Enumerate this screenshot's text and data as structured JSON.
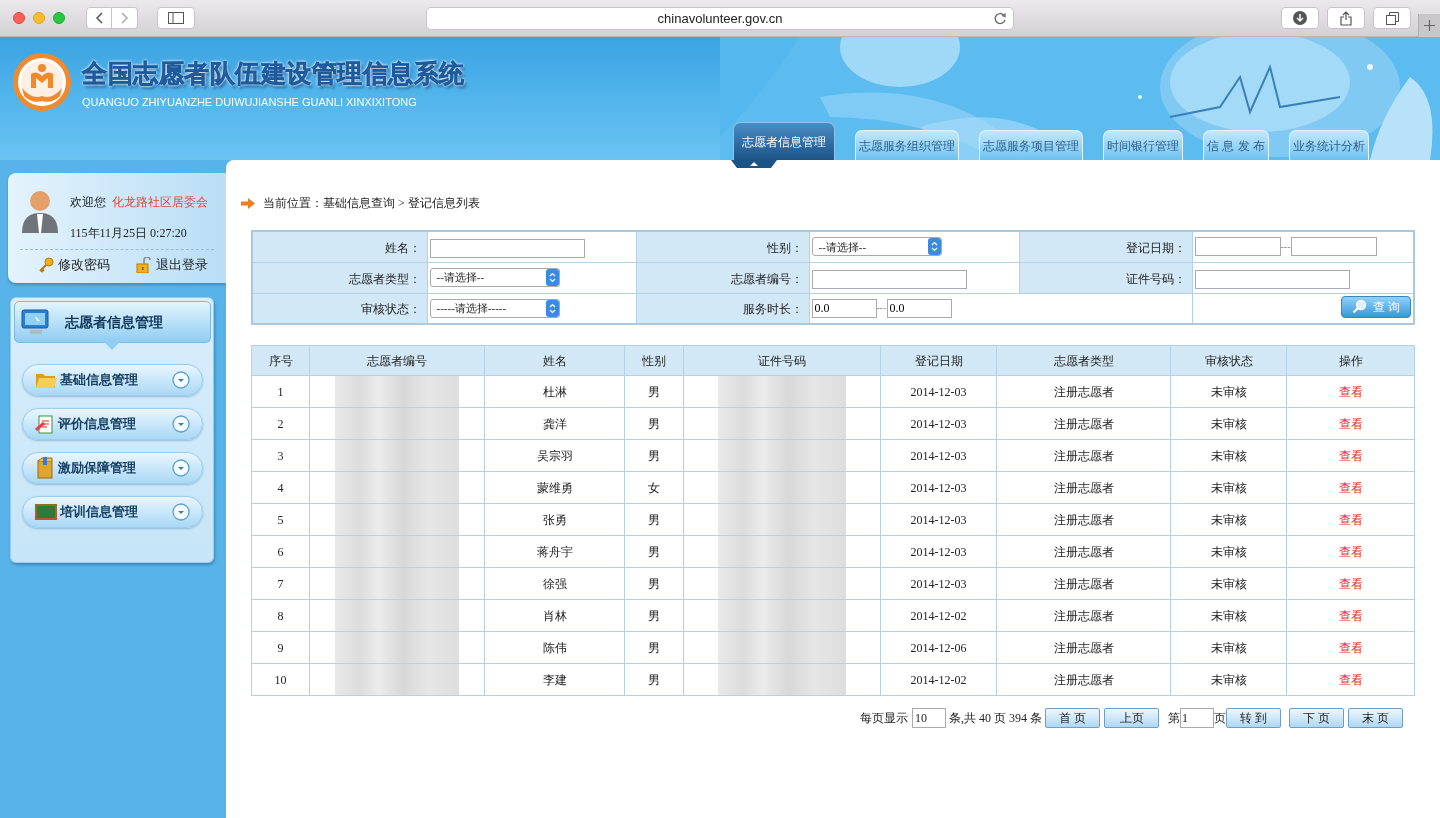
{
  "browser": {
    "url": "chinavolunteer.gov.cn"
  },
  "header": {
    "title": "全国志愿者队伍建设管理信息系统",
    "subtitle": "QUANGUO ZHIYUANZHE DUIWUJIANSHE GUANLI XINXIXITONG"
  },
  "nav_tabs": [
    {
      "label": "志愿者信息管理",
      "selected": true
    },
    {
      "label": "志愿服务组织管理",
      "selected": false
    },
    {
      "label": "志愿服务项目管理",
      "selected": false
    },
    {
      "label": "时间银行管理",
      "selected": false
    },
    {
      "label": "信 息 发 布",
      "selected": false
    },
    {
      "label": "业务统计分析",
      "selected": false
    }
  ],
  "user_panel": {
    "greeting": "欢迎您",
    "user_name": "化龙路社区居委会",
    "datetime": "115年11月25日 0:27:20",
    "links": [
      {
        "kind": "key",
        "label": "修改密码"
      },
      {
        "kind": "lock",
        "label": "退出登录"
      }
    ]
  },
  "sidebar": {
    "title": "志愿者信息管理",
    "items": [
      {
        "kind": "folder",
        "label": "基础信息管理"
      },
      {
        "kind": "clipboard",
        "label": "评价信息管理"
      },
      {
        "kind": "box",
        "label": "激励保障管理"
      },
      {
        "kind": "board",
        "label": "培训信息管理"
      }
    ]
  },
  "breadcrumb": "当前位置：基础信息查询 > 登记信息列表",
  "search_form": {
    "rows": [
      [
        {
          "label": "姓名：",
          "kind": "text"
        },
        {
          "label": "性别：",
          "kind": "select",
          "value": "--请选择--"
        },
        {
          "label": "登记日期：",
          "kind": "range",
          "separator": "---"
        }
      ],
      [
        {
          "label": "志愿者类型：",
          "kind": "select",
          "value": "--请选择--"
        },
        {
          "label": "志愿者编号：",
          "kind": "text"
        },
        {
          "label": "证件号码：",
          "kind": "text"
        }
      ],
      [
        {
          "label": "审核状态：",
          "kind": "select",
          "value": "-----请选择-----"
        },
        {
          "label": "服务时长：",
          "kind": "range",
          "from": "0.0",
          "separator": "---",
          "to": "0.0"
        }
      ]
    ],
    "button": "查 询"
  },
  "table": {
    "columns": [
      "序号",
      "志愿者编号",
      "姓名",
      "性别",
      "证件号码",
      "登记日期",
      "志愿者类型",
      "审核状态",
      "操作"
    ],
    "rows": [
      {
        "no": "1",
        "name": "杜淋",
        "gender": "男",
        "date": "2014-12-03",
        "type": "注册志愿者",
        "status": "未审核",
        "action": "查看"
      },
      {
        "no": "2",
        "name": "龚洋",
        "gender": "男",
        "date": "2014-12-03",
        "type": "注册志愿者",
        "status": "未审核",
        "action": "查看"
      },
      {
        "no": "3",
        "name": "吴宗羽",
        "gender": "男",
        "date": "2014-12-03",
        "type": "注册志愿者",
        "status": "未审核",
        "action": "查看"
      },
      {
        "no": "4",
        "name": "蒙维勇",
        "gender": "女",
        "date": "2014-12-03",
        "type": "注册志愿者",
        "status": "未审核",
        "action": "查看"
      },
      {
        "no": "5",
        "name": "张勇",
        "gender": "男",
        "date": "2014-12-03",
        "type": "注册志愿者",
        "status": "未审核",
        "action": "查看"
      },
      {
        "no": "6",
        "name": "蒋舟宇",
        "gender": "男",
        "date": "2014-12-03",
        "type": "注册志愿者",
        "status": "未审核",
        "action": "查看"
      },
      {
        "no": "7",
        "name": "徐强",
        "gender": "男",
        "date": "2014-12-03",
        "type": "注册志愿者",
        "status": "未审核",
        "action": "查看"
      },
      {
        "no": "8",
        "name": "肖林",
        "gender": "男",
        "date": "2014-12-02",
        "type": "注册志愿者",
        "status": "未审核",
        "action": "查看"
      },
      {
        "no": "9",
        "name": "陈伟",
        "gender": "男",
        "date": "2014-12-06",
        "type": "注册志愿者",
        "status": "未审核",
        "action": "查看"
      },
      {
        "no": "10",
        "name": "李建",
        "gender": "男",
        "date": "2014-12-02",
        "type": "注册志愿者",
        "status": "未审核",
        "action": "查看"
      }
    ]
  },
  "pagination": {
    "per_page_label": "每页显示",
    "per_page": "10",
    "summary": "条,共 40 页 394 条",
    "first": "首 页",
    "prev": "上页",
    "page_prefix": "第",
    "page": "1",
    "page_suffix": "页",
    "go": "转 到",
    "next": "下 页",
    "last": "末 页"
  }
}
